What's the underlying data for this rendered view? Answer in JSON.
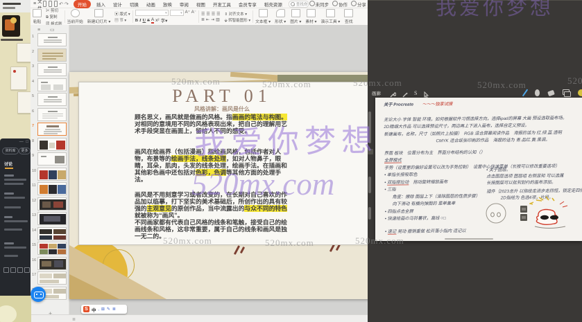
{
  "watermarks": {
    "gray": "520mx.com",
    "purple_main": "我爱你梦想",
    "purple_sub": "520mx.com",
    "purple_corner": "我爱你梦想",
    "gray_color": "#8c8c8c",
    "purple_color": "#9673d8"
  },
  "desktop": {
    "chat_buttons": [
      "资料库",
      "更多"
    ],
    "chat_tab": "讨论",
    "window_controls": "— □"
  },
  "ime": {
    "logo": "S",
    "mode": "中"
  },
  "wps": {
    "menu": {
      "file": "文件",
      "tabs": [
        {
          "label": "开始",
          "active": true
        },
        {
          "label": "插入"
        },
        {
          "label": "设计"
        },
        {
          "label": "切换"
        },
        {
          "label": "动画"
        },
        {
          "label": "放映"
        },
        {
          "label": "审阅"
        },
        {
          "label": "视图"
        },
        {
          "label": "开发工具"
        },
        {
          "label": "会员专享"
        },
        {
          "label": "稻壳资源"
        }
      ],
      "search_placeholder": "查找命令，搜索模板",
      "sync": "未同步",
      "collab": "协作",
      "share": "分享"
    },
    "ribbon": {
      "paste": "粘贴",
      "cut": "剪切",
      "copy": "复制",
      "format_painter": "格式刷",
      "from_current": "当前开始",
      "new_slide": "新建幻灯片",
      "layout": "版式",
      "section": "节",
      "bold": "B",
      "italic": "I",
      "underline": "U",
      "strike": "S",
      "align_text": "对齐文本",
      "smart_graphic": "转智能图形",
      "text_box": "文本框",
      "shape": "形状",
      "picture": "图片",
      "material": "素材",
      "demo_tools": "演示工具",
      "find": "查找",
      "font_placeholder": "",
      "size_placeholder": ""
    },
    "slide_panel": {
      "selected": 7,
      "slides": [
        {
          "n": 1,
          "kind": "text"
        },
        {
          "n": 2,
          "kind": "tan"
        },
        {
          "n": 3,
          "kind": "text"
        },
        {
          "n": 4,
          "kind": "text2"
        },
        {
          "n": 5,
          "kind": "text"
        },
        {
          "n": 6,
          "kind": "list"
        },
        {
          "n": 7,
          "kind": "title"
        },
        {
          "n": 8,
          "kind": "imgred"
        },
        {
          "n": 9,
          "kind": "textimg"
        },
        {
          "n": 10,
          "kind": "color1"
        },
        {
          "n": 11,
          "kind": "color2"
        },
        {
          "n": 12,
          "kind": "dark1"
        },
        {
          "n": 13,
          "kind": "dark2"
        },
        {
          "n": 14,
          "kind": "dark3"
        },
        {
          "n": 15,
          "kind": "grid"
        },
        {
          "n": 16,
          "kind": "dark4"
        },
        {
          "n": 17,
          "kind": "light"
        },
        {
          "n": 18,
          "kind": "light"
        }
      ]
    },
    "slide": {
      "title": "PART 01",
      "subtitle": "风格讲解：画风是什么",
      "paragraphs": [
        [
          {
            "t": "顾名思义，画风就是做画的风格。指"
          },
          {
            "t": "画画的笔法与构图。",
            "hl": true
          },
          {
            "t": "对相同的意境用不同的风格表现出来，把自己的理解用艺术手段突显在画面上，留给人不同的感受。"
          }
        ],
        [
          {
            "t": "画风在绘画界（包括漫画）指绘画风格，包括作者对人物，布景等的"
          },
          {
            "t": "绘画手法，线条处理",
            "hl": true
          },
          {
            "t": "，如对人物鼻子，眼睛，耳朵，肌肉，头发的线条处理，绘画手法。在插画和其他彩色画中还包括对"
          },
          {
            "t": "色彩，色调",
            "hl": true
          },
          {
            "t": "等其他方面的处理手法。"
          }
        ],
        [
          {
            "t": "画风是不用刻意学习或者改变的，在长期对自己喜欢的作品加以临摹，打下坚实的美术基础后，所创作出的具有较强的"
          },
          {
            "t": "主观意见",
            "hl": true
          },
          {
            "t": "的原创作品，当中流露出的"
          },
          {
            "t": "与众不同的特色",
            "hl": true
          },
          {
            "t": "就被称为“画风”。"
          },
          {
            "br": true
          },
          {
            "t": "不同画家都有代表自己风格的线条和笔触，接受自己的绘画线条和风格，这非常重要，属于自己的线条和画风是独一无二的。"
          }
        ]
      ]
    }
  },
  "procreate": {
    "gallery": "画廊",
    "selection_tool": "S",
    "notes_title": "关于 Procreate",
    "notes_badge": "～～～独家试摸",
    "left_lines": [
      {
        "t": "无论大小 字体 智能 环境，如何根据软件习惯选择方向，选择ipad的屏幕 大画 预设选取画布场。"
      },
      {
        "t": "2D精细大作品 可以选择预设尺寸，两边再上下进入画布，选择自定义预设。"
      },
      {
        "t": "新建画布，名称，尺寸（如照片上拍摄）　RGB 适合屏幕阅读作品　海报的话为 红.绿.蓝.透明"
      },
      {
        "t": "CMYK 适合纸张印刷的作品　海报的话为 青.品红.黄.黑调。",
        "indent": 96
      },
      {
        "t": "界面 板块　位置分布为主　界面分布结构的认知（）",
        "gap": 8
      },
      {
        "ru": "全屏模式",
        "post": ""
      },
      {
        "t": "手势（设置里的偏好设置可以改为手势控制）　设置中心快速菜单（长按可以修改重要选项）"
      },
      {
        "t": "单指长按吸取色",
        "bullet": true
      },
      {
        "ru": "双指捏拉动",
        "post": "　拖动旋转缩放画布",
        "bullet": true
      },
      {
        "t": "三指",
        "bullet": true
      },
      {
        "t": "角度：擦除 图层上下（清除图层的性质步骤）",
        "indent": 14
      },
      {
        "t": "向下滑动 有横向弹图的 菜单集单",
        "indent": 14
      },
      {
        "t": "四指点击全屏",
        "bullet": true
      },
      {
        "t": "快速绘画の马铃薯状，直线 ○□",
        "bullet": true
      },
      {
        "ru": "速记",
        "post": " 晃动 撤销重做 松开落小指内 适记以",
        "bullet": true,
        "gap": 10
      }
    ],
    "right_lines": [
      {
        "t": "关于图层。",
        "bullet": true
      },
      {
        "t": "点击图层选项 图层组 右侧显知 可以选属"
      },
      {
        "t": "长按图层可以批到划约的画布添加。"
      },
      {
        "t": "插件｛2023总升 以指绘走进步走四恒，锁定走四恒",
        "gap": 4
      },
      {
        "t": "2D指绘为 色选4项，片段。",
        "indent": 26
      }
    ]
  }
}
